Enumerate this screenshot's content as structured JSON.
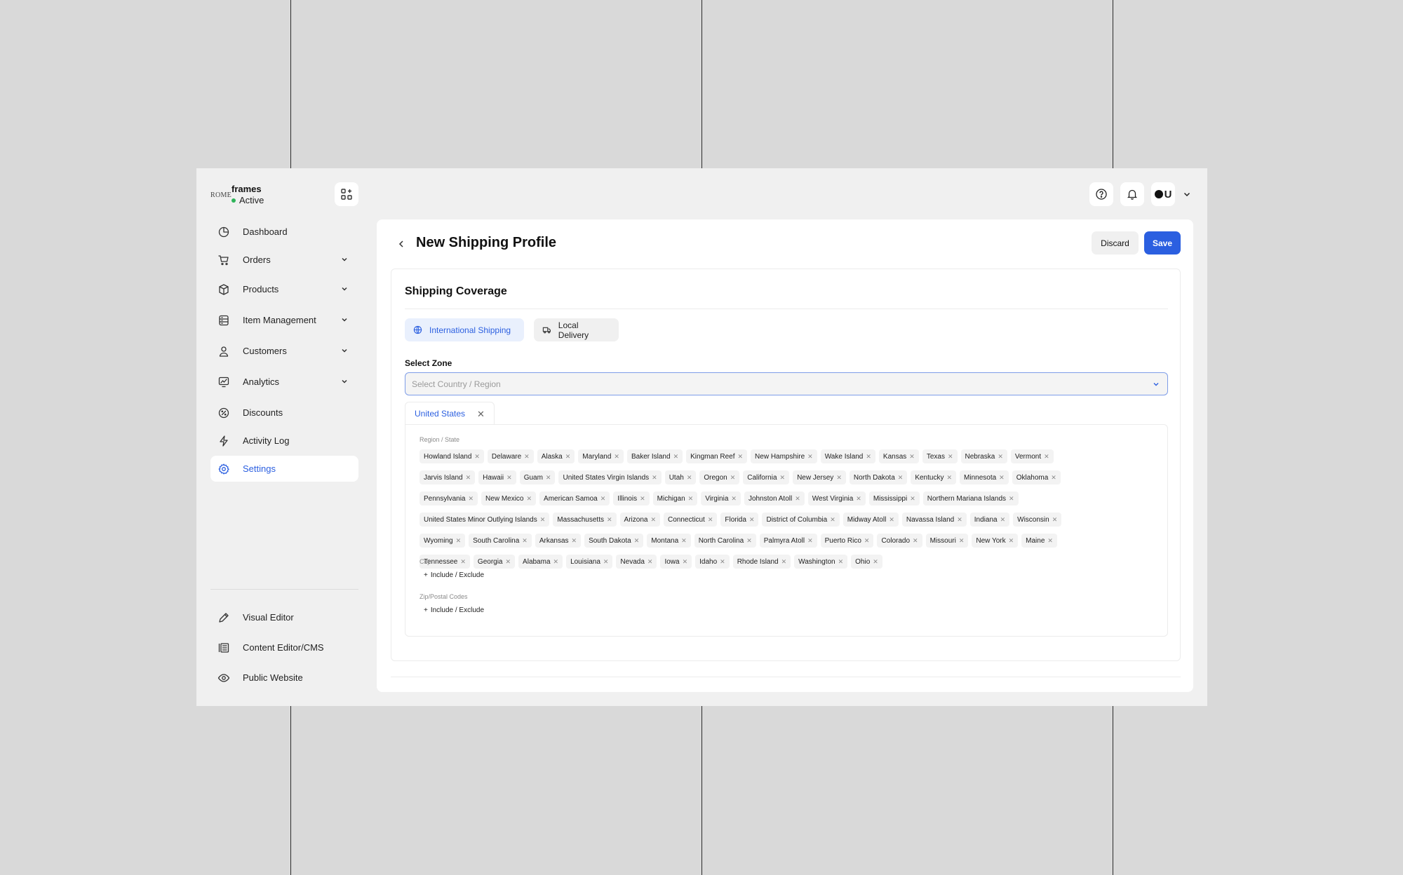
{
  "brand": {
    "logo_text": "ROME",
    "name": "frames",
    "status": "Active"
  },
  "nav": [
    {
      "label": "Dashboard",
      "icon": "dashboard-icon",
      "has_chevron": false,
      "active": false
    },
    {
      "label": "Orders",
      "icon": "cart-icon",
      "has_chevron": true,
      "active": false
    },
    {
      "label": "Products",
      "icon": "box-icon",
      "has_chevron": true,
      "active": false
    },
    {
      "label": "Item Management",
      "icon": "database-icon",
      "has_chevron": true,
      "active": false
    },
    {
      "label": "Customers",
      "icon": "user-icon",
      "has_chevron": true,
      "active": false
    },
    {
      "label": "Analytics",
      "icon": "chart-icon",
      "has_chevron": true,
      "active": false
    },
    {
      "label": "Discounts",
      "icon": "discount-icon",
      "has_chevron": false,
      "active": false
    },
    {
      "label": "Activity Log",
      "icon": "bolt-icon",
      "has_chevron": false,
      "active": false
    },
    {
      "label": "Settings",
      "icon": "gear-icon",
      "has_chevron": false,
      "active": true
    }
  ],
  "nav_bottom": [
    {
      "label": "Visual Editor",
      "icon": "pencil-icon"
    },
    {
      "label": "Content Editor/CMS",
      "icon": "cms-icon"
    },
    {
      "label": "Public Website",
      "icon": "eye-icon"
    }
  ],
  "header": {
    "title": "New Shipping Profile",
    "discard_label": "Discard",
    "save_label": "Save",
    "avatar_letter": "U"
  },
  "coverage": {
    "title": "Shipping Coverage",
    "tabs": [
      {
        "label": "International Shipping",
        "icon": "globe-icon",
        "active": true
      },
      {
        "label": "Local Delivery",
        "icon": "truck-icon",
        "active": false
      }
    ],
    "zone_label": "Select Zone",
    "zone_placeholder": "Select Country / Region",
    "country_tab": "United States",
    "region_label": "Region / State",
    "regions": [
      "Howland Island",
      "Delaware",
      "Alaska",
      "Maryland",
      "Baker Island",
      "Kingman Reef",
      "New Hampshire",
      "Wake Island",
      "Kansas",
      "Texas",
      "Nebraska",
      "Vermont",
      "Jarvis Island",
      "Hawaii",
      "Guam",
      "United States Virgin Islands",
      "Utah",
      "Oregon",
      "California",
      "New Jersey",
      "North Dakota",
      "Kentucky",
      "Minnesota",
      "Oklahoma",
      "Pennsylvania",
      "New Mexico",
      "American Samoa",
      "Illinois",
      "Michigan",
      "Virginia",
      "Johnston Atoll",
      "West Virginia",
      "Mississippi",
      "Northern Mariana Islands",
      "United States Minor Outlying Islands",
      "Massachusetts",
      "Arizona",
      "Connecticut",
      "Florida",
      "District of Columbia",
      "Midway Atoll",
      "Navassa Island",
      "Indiana",
      "Wisconsin",
      "Wyoming",
      "South Carolina",
      "Arkansas",
      "South Dakota",
      "Montana",
      "North Carolina",
      "Palmyra Atoll",
      "Puerto Rico",
      "Colorado",
      "Missouri",
      "New York",
      "Maine",
      "Tennessee",
      "Georgia",
      "Alabama",
      "Louisiana",
      "Nevada",
      "Iowa",
      "Idaho",
      "Rhode Island",
      "Washington",
      "Ohio"
    ],
    "rows": [
      12,
      12,
      10,
      10,
      12,
      10
    ],
    "city_label": "City",
    "zip_label": "Zip/Postal Codes",
    "include_exclude": "Include / Exclude"
  }
}
